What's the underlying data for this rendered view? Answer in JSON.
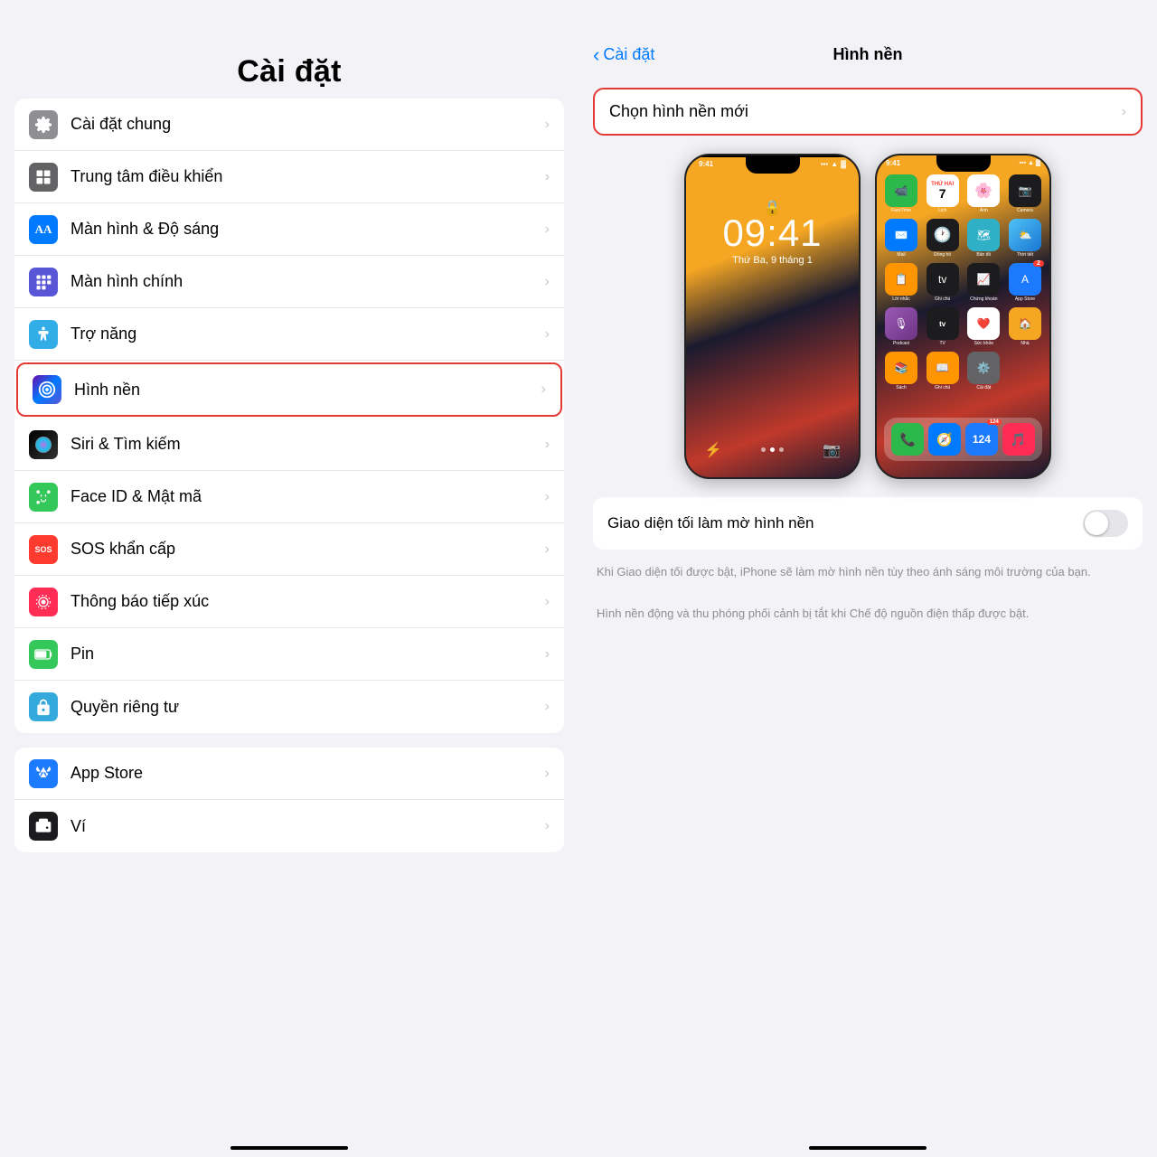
{
  "left": {
    "title": "Cài đặt",
    "sections": [
      {
        "items": [
          {
            "id": "cai-dat-chung",
            "label": "Cài đặt chung",
            "iconBg": "icon-gray",
            "iconSymbol": "⚙️",
            "highlighted": false
          },
          {
            "id": "trung-tam-dieu-khien",
            "label": "Trung tâm điều khiển",
            "iconBg": "icon-gray2",
            "iconSymbol": "🎛",
            "highlighted": false
          },
          {
            "id": "man-hinh-do-sang",
            "label": "Màn hình & Độ sáng",
            "iconBg": "icon-blue",
            "iconSymbol": "AA",
            "highlighted": false
          },
          {
            "id": "man-hinh-chinh",
            "label": "Màn hình chính",
            "iconBg": "icon-blue2",
            "iconSymbol": "⊞",
            "highlighted": false
          },
          {
            "id": "tro-nang",
            "label": "Trợ năng",
            "iconBg": "icon-blue3",
            "iconSymbol": "♿",
            "highlighted": false
          },
          {
            "id": "hinh-nen",
            "label": "Hình nền",
            "iconBg": "icon-wallpaper",
            "iconSymbol": "✿",
            "highlighted": true
          },
          {
            "id": "siri-tim-kiem",
            "label": "Siri & Tìm kiếm",
            "iconBg": "icon-gray2",
            "iconSymbol": "◉",
            "highlighted": false
          },
          {
            "id": "face-id-mat-ma",
            "label": "Face ID & Mật mã",
            "iconBg": "icon-green",
            "iconSymbol": "😊",
            "highlighted": false
          },
          {
            "id": "sos-khan-cap",
            "label": "SOS khẩn cấp",
            "iconBg": "icon-red",
            "iconSymbol": "SOS",
            "highlighted": false
          },
          {
            "id": "thong-bao-tiep-xuc",
            "label": "Thông báo tiếp xúc",
            "iconBg": "icon-red2",
            "iconSymbol": "✳",
            "highlighted": false
          },
          {
            "id": "pin",
            "label": "Pin",
            "iconBg": "icon-green2",
            "iconSymbol": "🔋",
            "highlighted": false
          },
          {
            "id": "quyen-rieng-tu",
            "label": "Quyền riêng tư",
            "iconBg": "icon-blue4",
            "iconSymbol": "✋",
            "highlighted": false
          }
        ]
      },
      {
        "items": [
          {
            "id": "app-store",
            "label": "App Store",
            "iconBg": "icon-appstore",
            "iconSymbol": "A",
            "highlighted": false
          },
          {
            "id": "vi",
            "label": "Ví",
            "iconBg": "icon-gray2",
            "iconSymbol": "💳",
            "highlighted": false
          }
        ]
      }
    ]
  },
  "right": {
    "back_label": "Cài đặt",
    "title": "Hình nền",
    "choose_new_label": "Chọn hình nền mới",
    "toggle_label": "Giao diện tối làm mờ hình nền",
    "info_text1": "Khi Giao diện tối được bật, iPhone sẽ làm mờ hình nền tùy theo ánh sáng môi trường của bạn.",
    "info_text2": "Hình nền động và thu phóng phối cảnh bị tắt khi Chế độ nguồn điện thấp được bật.",
    "lock_time": "09:41",
    "lock_date": "Thứ Ba, 9 tháng 1",
    "home_status_time": "9:41"
  },
  "chevron": "›",
  "back_chevron": "‹"
}
